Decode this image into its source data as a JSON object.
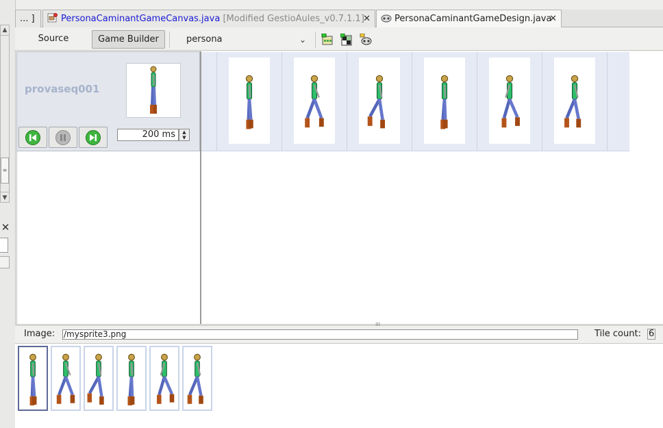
{
  "tabs": [
    {
      "label": "... ]"
    },
    {
      "label": "PersonaCaminantGameCanvas.java",
      "suffix": "[Modified GestioAules_v0.7.1.1]",
      "close": "✕"
    },
    {
      "label": "PersonaCaminantGameDesign.java",
      "close": "✕"
    }
  ],
  "toolbar": {
    "source_label": "Source",
    "game_builder_label": "Game Builder",
    "combo_value": "persona",
    "icons": [
      "new-tiled-layer-icon",
      "new-scene-icon",
      "new-sprite-icon"
    ]
  },
  "sequence": {
    "name": "provaseq001",
    "delay_value": "200 ms",
    "buttons": [
      "previous-frame-icon",
      "pause-icon",
      "next-frame-icon"
    ]
  },
  "frames": {
    "count": 6
  },
  "image_row": {
    "label": "Image:",
    "value": "/mysprite3.png",
    "tile_count_label": "Tile count:",
    "tile_count_value": "6"
  },
  "left_strip": {
    "close": "✕"
  },
  "colors": {
    "link_blue": "#1a1ad6",
    "seq_name": "#a6b3cc",
    "strip_bg": "#e6eaf5",
    "selected_tile_border": "#5d6896",
    "play_green": "#3fb53f"
  }
}
